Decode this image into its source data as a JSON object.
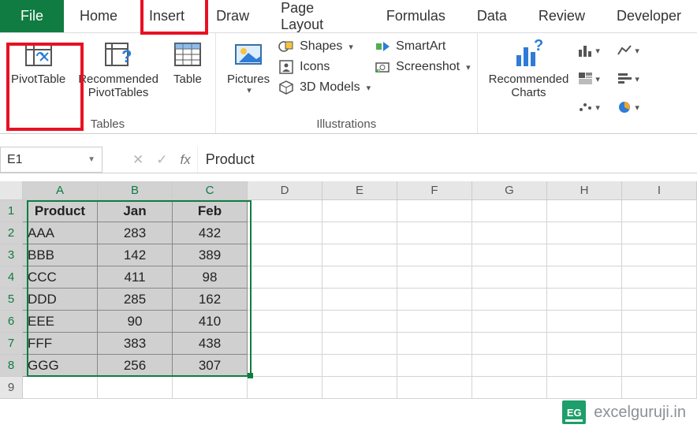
{
  "tabs": {
    "file": "File",
    "home": "Home",
    "insert": "Insert",
    "draw": "Draw",
    "pagelayout": "Page Layout",
    "formulas": "Formulas",
    "data": "Data",
    "review": "Review",
    "developer": "Developer"
  },
  "ribbon": {
    "tables": {
      "pivot": "PivotTable",
      "recommended": "Recommended\nPivotTables",
      "table": "Table",
      "group": "Tables"
    },
    "illus": {
      "pictures": "Pictures",
      "shapes": "Shapes",
      "icons": "Icons",
      "models": "3D Models",
      "smartart": "SmartArt",
      "screenshot": "Screenshot",
      "group": "Illustrations"
    },
    "charts": {
      "recommended": "Recommended\nCharts"
    }
  },
  "fbar": {
    "name": "E1",
    "value": "Product"
  },
  "cols": [
    "A",
    "B",
    "C",
    "D",
    "E",
    "F",
    "G",
    "H",
    "I"
  ],
  "chart_data": {
    "type": "table",
    "headers": [
      "Product",
      "Jan",
      "Feb"
    ],
    "rows": [
      [
        "AAA",
        283,
        432
      ],
      [
        "BBB",
        142,
        389
      ],
      [
        "CCC",
        411,
        98
      ],
      [
        "DDD",
        285,
        162
      ],
      [
        "EEE",
        90,
        410
      ],
      [
        "FFF",
        383,
        438
      ],
      [
        "GGG",
        256,
        307
      ]
    ]
  },
  "watermark": "excelguruji.in",
  "logo": "EG"
}
